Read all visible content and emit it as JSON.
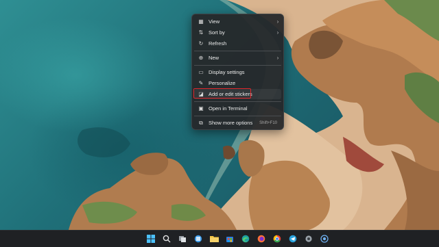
{
  "context_menu": {
    "items": [
      {
        "label": "View",
        "icon": "view-grid-icon",
        "has_submenu": true
      },
      {
        "label": "Sort by",
        "icon": "sort-icon",
        "has_submenu": true
      },
      {
        "label": "Refresh",
        "icon": "refresh-icon",
        "has_submenu": false
      },
      {
        "label": "New",
        "icon": "new-plus-icon",
        "has_submenu": true
      },
      {
        "label": "Display settings",
        "icon": "display-icon",
        "has_submenu": false
      },
      {
        "label": "Personalize",
        "icon": "brush-icon",
        "has_submenu": false
      },
      {
        "label": "Add or edit stickers",
        "icon": "sticker-icon",
        "has_submenu": false,
        "highlighted": true
      },
      {
        "label": "Open in Terminal",
        "icon": "terminal-icon",
        "has_submenu": false
      },
      {
        "label": "Show more options",
        "icon": "more-options-icon",
        "shortcut": "Shift+F10"
      }
    ],
    "highlight_color": "#e0262b"
  },
  "taskbar": {
    "icons": [
      "windows-start-icon",
      "search-icon",
      "task-view-icon",
      "widgets-icon",
      "file-explorer-icon",
      "microsoft-store-icon",
      "edge-icon",
      "firefox-icon",
      "chrome-icon",
      "telegram-icon",
      "settings-icon",
      "app-icon"
    ]
  }
}
